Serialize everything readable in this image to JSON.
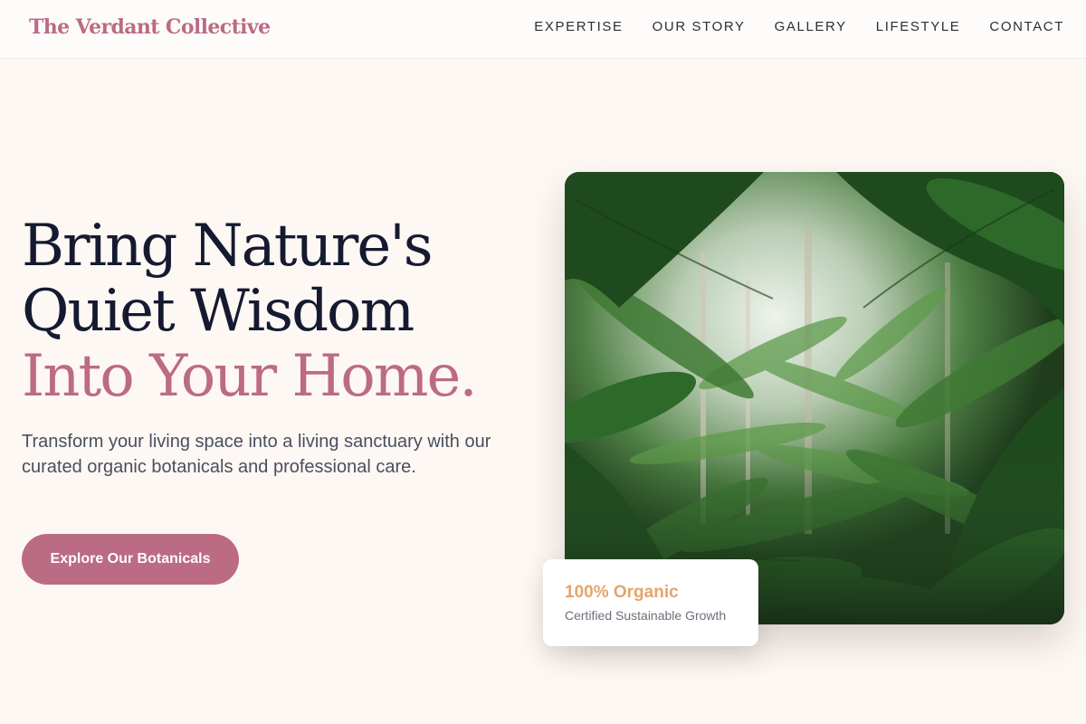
{
  "header": {
    "logo": "The Verdant Collective",
    "nav": [
      "EXPERTISE",
      "OUR STORY",
      "GALLERY",
      "LIFESTYLE",
      "CONTACT"
    ]
  },
  "hero": {
    "title_line1": "Bring Nature's",
    "title_line2": "Quiet Wisdom",
    "title_line3": "Into Your Home.",
    "subtitle": "Transform your living space into a living sanctuary with our curated organic botanicals and professional care.",
    "cta_label": "Explore Our Botanicals"
  },
  "badge": {
    "title": "100% Organic",
    "subtitle": "Certified Sustainable Growth"
  },
  "colors": {
    "accent": "#bc6b85",
    "badge_title": "#e3a56a",
    "background": "#fdf8f4",
    "text_dark": "#151a30"
  }
}
